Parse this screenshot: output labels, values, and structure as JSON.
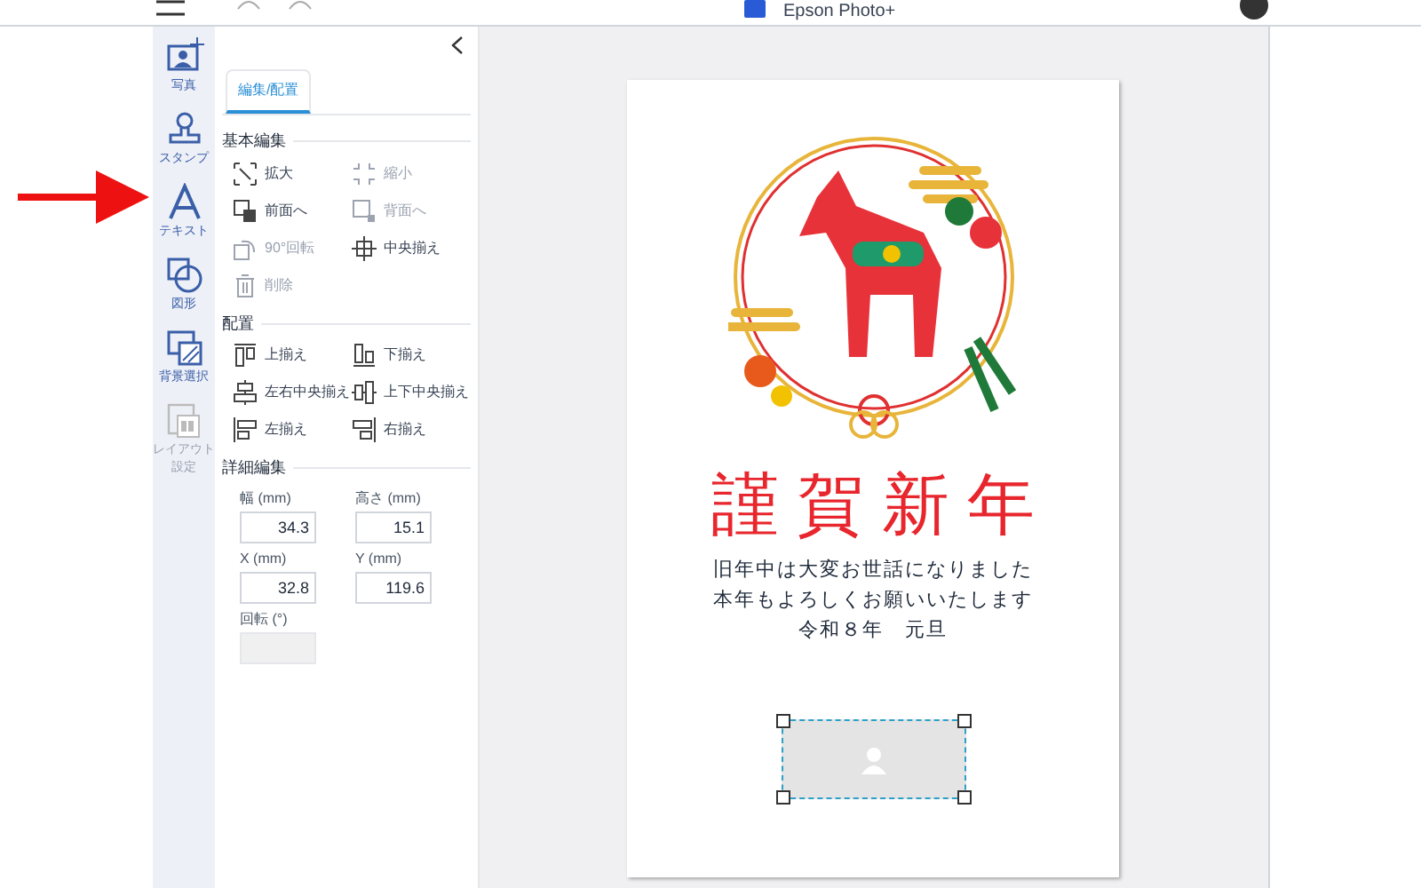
{
  "app_bar": {
    "title": "Epson Photo+"
  },
  "side_rail": [
    {
      "label": "写真",
      "kind": "photo",
      "disabled": false
    },
    {
      "label": "スタンプ",
      "kind": "stamp",
      "disabled": false
    },
    {
      "label": "テキスト",
      "kind": "text",
      "disabled": false
    },
    {
      "label": "図形",
      "kind": "shape",
      "disabled": false
    },
    {
      "label": "背景選択",
      "kind": "background",
      "disabled": false
    },
    {
      "label": "レイアウト設定",
      "kind": "layout",
      "disabled": true
    }
  ],
  "panel": {
    "tabs": [
      {
        "label": "編集/配置",
        "selected": true
      }
    ],
    "sections": [
      {
        "title": "基本編集",
        "items": [
          {
            "label": "拡大",
            "kind": "enlarge",
            "disabled": false
          },
          {
            "label": "縮小",
            "kind": "shrink",
            "disabled": true
          },
          {
            "label": "前面へ",
            "kind": "front",
            "disabled": false
          },
          {
            "label": "背面へ",
            "kind": "back",
            "disabled": true
          },
          {
            "label": "90°回転",
            "kind": "rotate",
            "disabled": true
          },
          {
            "label": "中央揃え",
            "kind": "center",
            "disabled": false
          },
          {
            "label": "削除",
            "kind": "delete",
            "disabled": true
          }
        ]
      },
      {
        "title": "配置",
        "items": [
          {
            "label": "上揃え",
            "kind": "top",
            "disabled": false
          },
          {
            "label": "下揃え",
            "kind": "bottom",
            "disabled": false
          },
          {
            "label": "左右中央揃え",
            "kind": "hcenter",
            "disabled": false
          },
          {
            "label": "上下中央揃え",
            "kind": "vcenter",
            "disabled": false
          },
          {
            "label": "左揃え",
            "kind": "left",
            "disabled": false
          },
          {
            "label": "右揃え",
            "kind": "right",
            "disabled": false
          }
        ]
      }
    ],
    "details": {
      "title": "詳細編集",
      "fields": [
        {
          "label": "幅 (mm)",
          "value": "34.3",
          "disabled": false
        },
        {
          "label": "高さ (mm)",
          "value": "15.1",
          "disabled": false
        },
        {
          "label": "X (mm)",
          "value": "32.8",
          "disabled": false
        },
        {
          "label": "Y (mm)",
          "value": "119.6",
          "disabled": false
        },
        {
          "label": "回転 (°)",
          "disabled": true
        }
      ]
    }
  },
  "card": {
    "heading": "謹賀新年",
    "message": [
      "旧年中は大変お世話になりました",
      "本年もよろしくお願いいたします",
      "令和８年　元旦"
    ]
  }
}
